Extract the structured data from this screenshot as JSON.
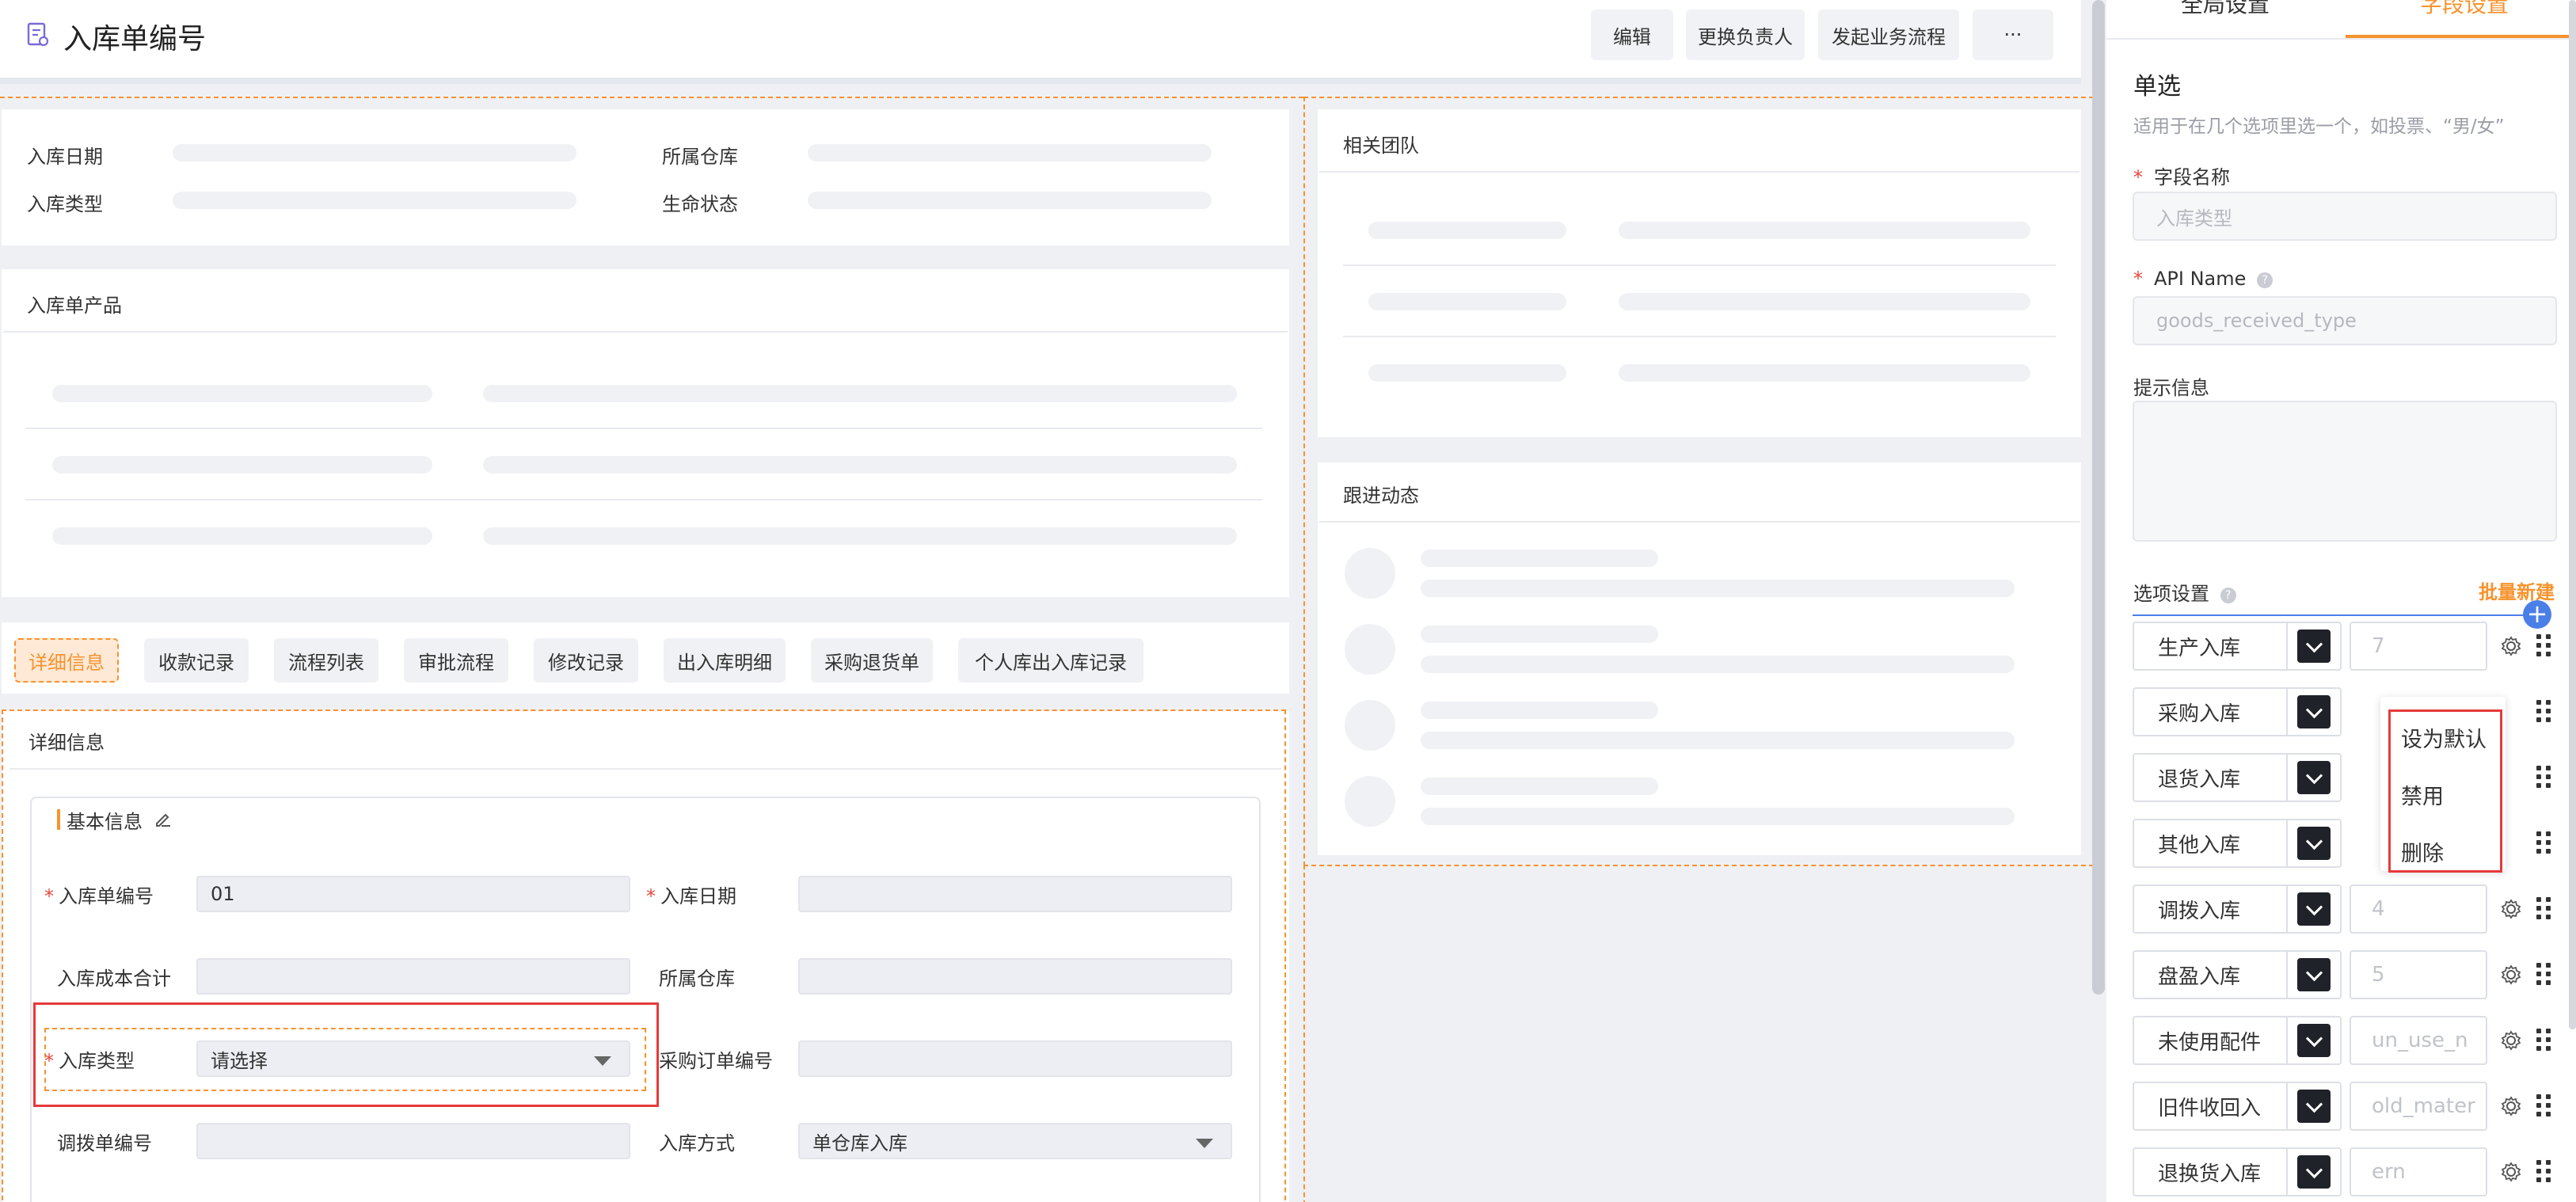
{
  "header": {
    "title": "入库单编号",
    "buttons": {
      "edit": "编辑",
      "change_owner": "更换负责人",
      "start_flow": "发起业务流程",
      "more": "···"
    }
  },
  "summary": {
    "fields": [
      "入库日期",
      "所属仓库",
      "入库类型",
      "生命状态"
    ]
  },
  "products": {
    "title": "入库单产品"
  },
  "team": {
    "title": "相关团队"
  },
  "followup": {
    "title": "跟进动态"
  },
  "tabs": [
    "详细信息",
    "收款记录",
    "流程列表",
    "审批流程",
    "修改记录",
    "出入库明细",
    "采购退货单",
    "个人库出入库记录"
  ],
  "detail": {
    "title": "详细信息",
    "section_title": "基本信息",
    "fields": {
      "receipt_no_label": "入库单编号",
      "receipt_no_value": "01",
      "receipt_date_label": "入库日期",
      "cost_total_label": "入库成本合计",
      "warehouse_label": "所属仓库",
      "receipt_type_label": "入库类型",
      "receipt_type_placeholder": "请选择",
      "po_no_label": "采购订单编号",
      "transfer_no_label": "调拨单编号",
      "receipt_method_label": "入库方式",
      "receipt_method_value": "单仓库入库"
    }
  },
  "right_panel": {
    "tabs": {
      "global": "全局设置",
      "field": "字段设置"
    },
    "field_type": "单选",
    "field_type_desc": "适用于在几个选项里选一个，如投票、“男/女”",
    "field_name_label": "字段名称",
    "field_name_placeholder": "入库类型",
    "api_name_label": "API Name",
    "api_name_placeholder": "goods_received_type",
    "hint_label": "提示信息",
    "options_label": "选项设置",
    "batch_create": "批量新建",
    "options": [
      {
        "name": "生产入库",
        "value": "7"
      },
      {
        "name": "采购入库",
        "value": ""
      },
      {
        "name": "退货入库",
        "value": ""
      },
      {
        "name": "其他入库",
        "value": ""
      },
      {
        "name": "调拨入库",
        "value": "4"
      },
      {
        "name": "盘盈入库",
        "value": "5"
      },
      {
        "name": "未使用配件",
        "value": "un_use_n"
      },
      {
        "name": "旧件收回入",
        "value": "old_mater"
      },
      {
        "name": "退换货入库",
        "value": "ern"
      }
    ],
    "context_menu": {
      "set_default": "设为默认",
      "disable": "禁用",
      "delete": "删除"
    }
  },
  "colors": {
    "accent": "#f7932e",
    "highlight_red": "#e63a3a",
    "swatch": "#1f2228"
  }
}
